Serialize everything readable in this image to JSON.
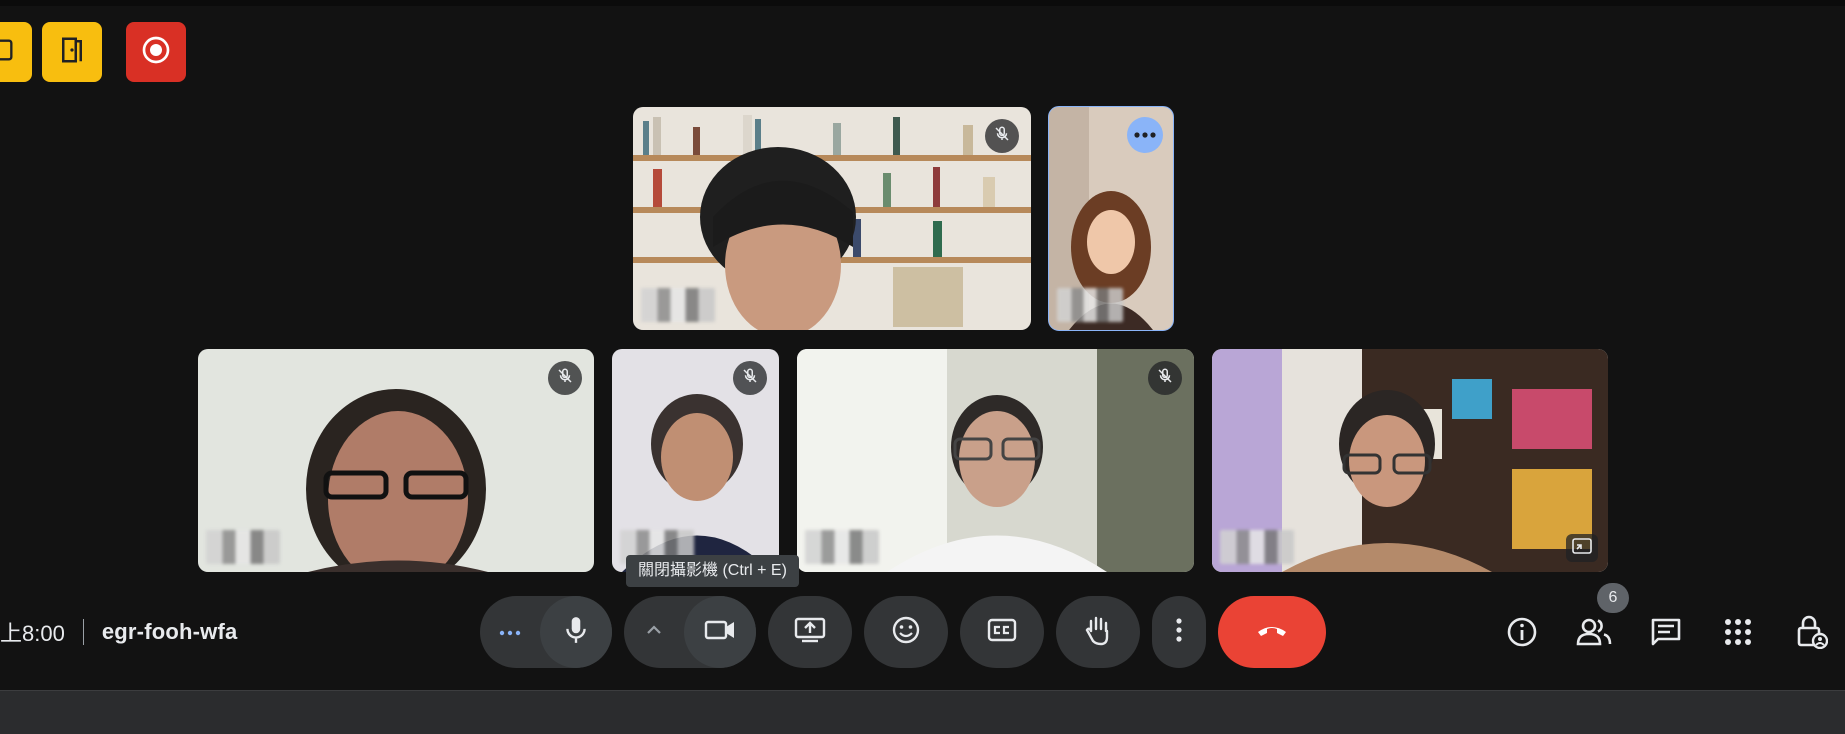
{
  "meeting": {
    "time": "上8:00",
    "code": "egr-fooh-wfa"
  },
  "tooltip": {
    "text": "關閉攝影機 (Ctrl + E)"
  },
  "participants_badge": "6",
  "colors": {
    "background": "#121212",
    "control_bg": "#333537",
    "end_call": "#ea4335",
    "active_outline": "#8ab4f8",
    "app_yellow": "#f8be0f",
    "app_red": "#d93025"
  },
  "icons": {
    "top_left": [
      "whiteboard-icon",
      "door-exit-icon",
      "record-icon"
    ],
    "controls": [
      "more-dots-icon",
      "microphone-icon",
      "chevron-up-icon",
      "camera-icon",
      "present-screen-icon",
      "emoji-icon",
      "captions-icon",
      "raise-hand-icon",
      "more-vert-icon",
      "end-call-icon"
    ],
    "right": [
      "info-icon",
      "people-icon",
      "chat-icon",
      "activities-icon",
      "host-controls-icon"
    ]
  }
}
